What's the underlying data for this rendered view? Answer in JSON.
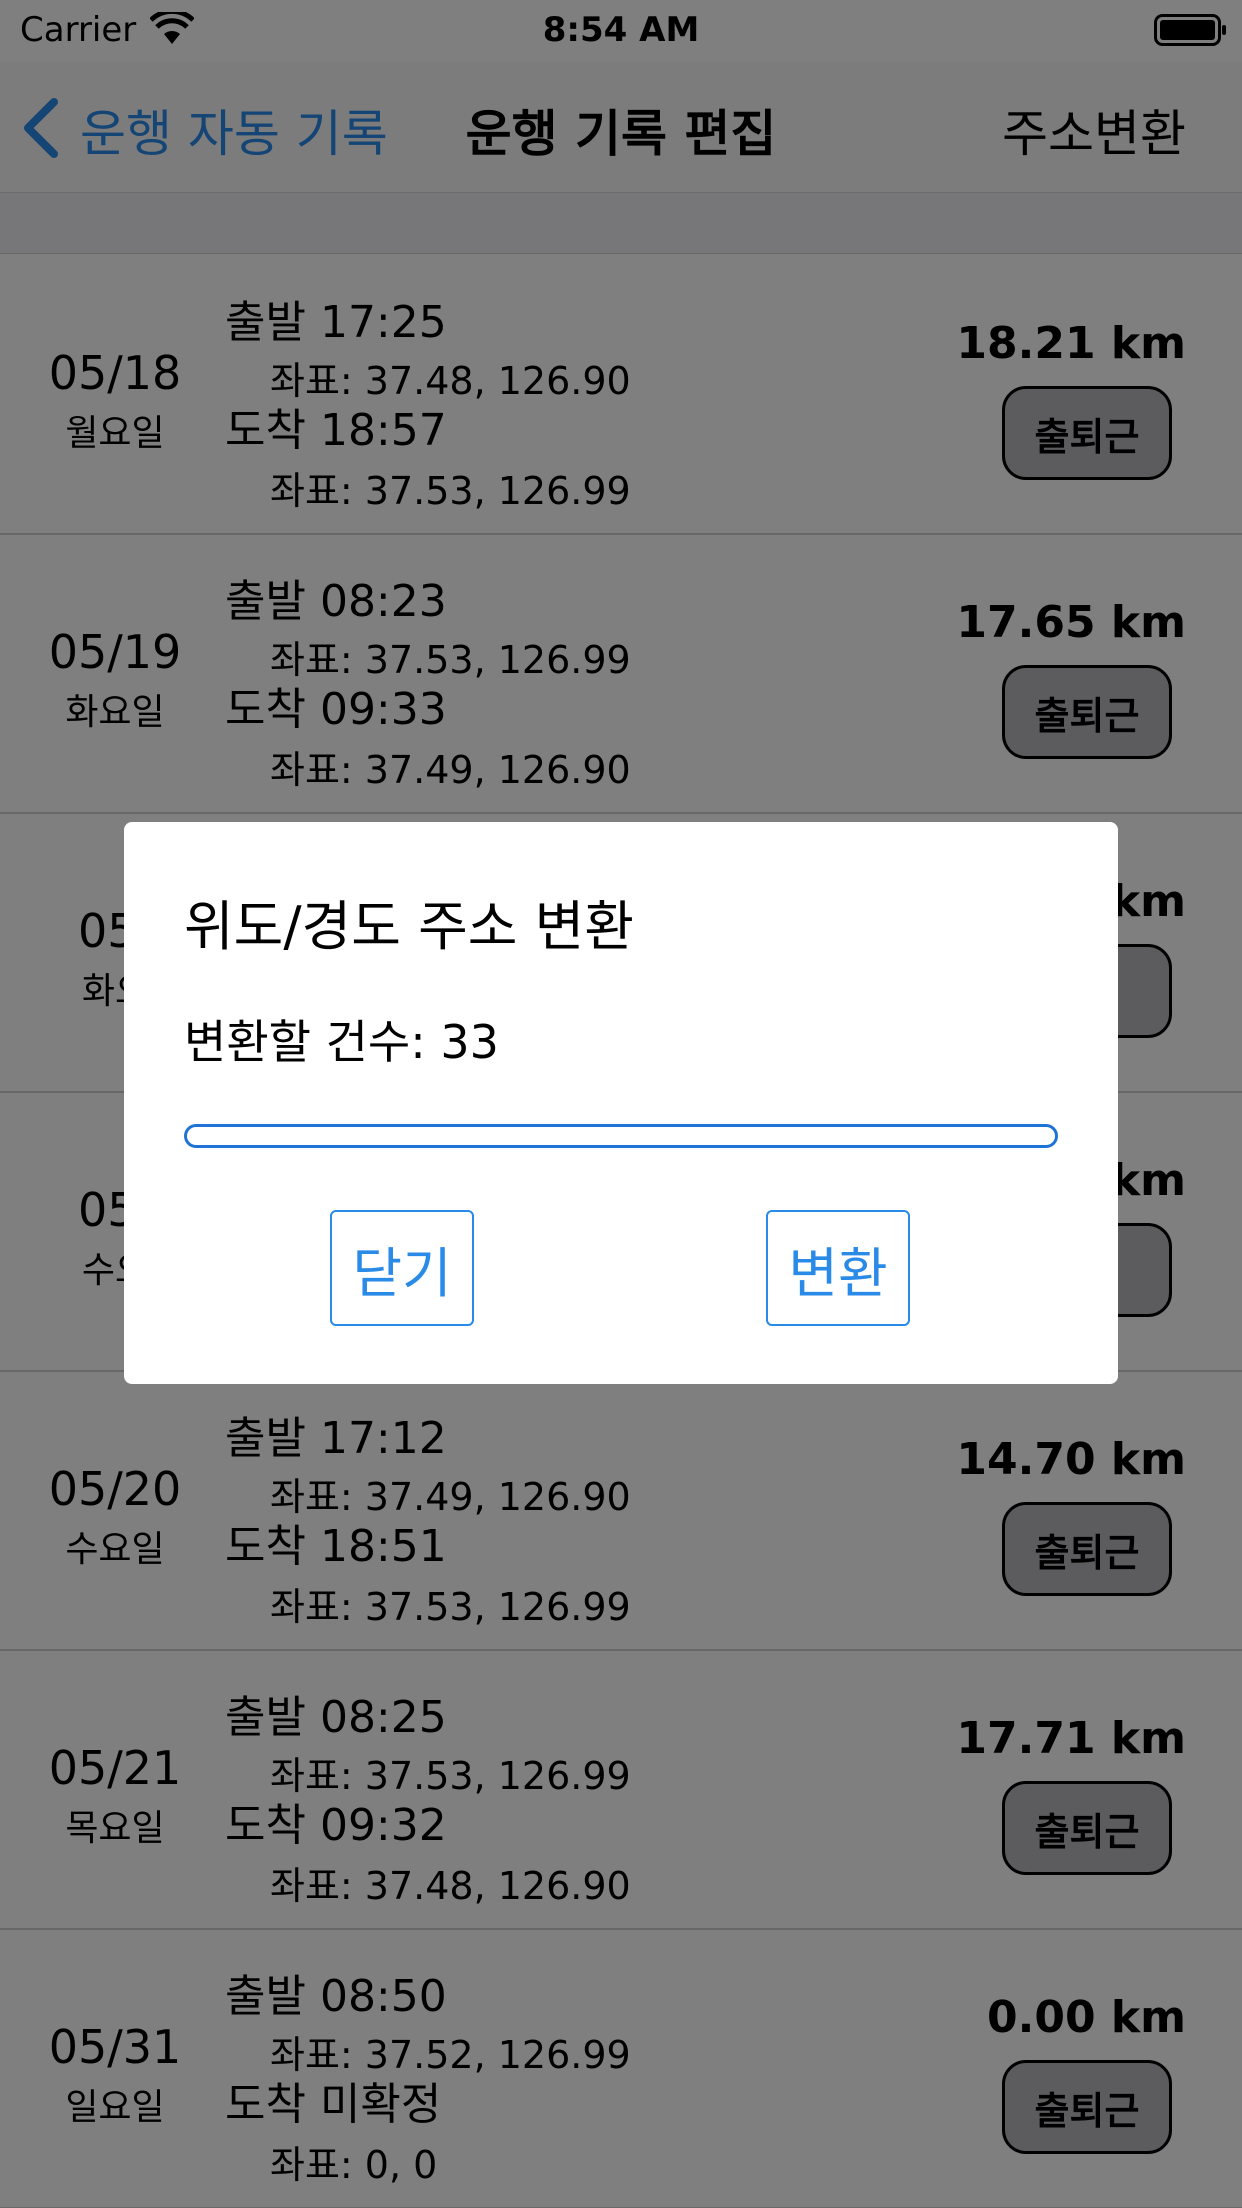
{
  "status_bar": {
    "carrier": "Carrier",
    "time": "8:54 AM"
  },
  "nav": {
    "back_label": "운행 자동 기록",
    "title": "운행 기록 편집",
    "right_action": "주소변환"
  },
  "trips": [
    {
      "date": "05/18",
      "weekday": "월요일",
      "depart": "출발 17:25",
      "depart_coord": "좌표: 37.48, 126.90",
      "arrive": "도착 18:57",
      "arrive_coord": "좌표: 37.53, 126.99",
      "distance": "18.21 km",
      "category": "출퇴근"
    },
    {
      "date": "05/19",
      "weekday": "화요일",
      "depart": "출발 08:23",
      "depart_coord": "좌표: 37.53, 126.99",
      "arrive": "도착 09:33",
      "arrive_coord": "좌표: 37.49, 126.90",
      "distance": "17.65 km",
      "category": "출퇴근"
    },
    {
      "date": "05/",
      "weekday": "화요",
      "distance": "km",
      "category": "근"
    },
    {
      "date": "05/",
      "weekday": "수요",
      "distance": "km",
      "category": "근"
    },
    {
      "date": "05/20",
      "weekday": "수요일",
      "depart": "출발 17:12",
      "depart_coord": "좌표: 37.49, 126.90",
      "arrive": "도착 18:51",
      "arrive_coord": "좌표: 37.53, 126.99",
      "distance": "14.70 km",
      "category": "출퇴근"
    },
    {
      "date": "05/21",
      "weekday": "목요일",
      "depart": "출발 08:25",
      "depart_coord": "좌표: 37.53, 126.99",
      "arrive": "도착 09:32",
      "arrive_coord": "좌표: 37.48, 126.90",
      "distance": "17.71 km",
      "category": "출퇴근"
    },
    {
      "date": "05/31",
      "weekday": "일요일",
      "depart": "출발 08:50",
      "depart_coord": "좌표: 37.52, 126.99",
      "arrive": "도착 미확정",
      "arrive_coord": "좌표: 0, 0",
      "distance": "0.00 km",
      "category": "출퇴근"
    }
  ],
  "dialog": {
    "title": "위도/경도 주소 변환",
    "count_text": "변환할 건수: 33",
    "progress": 0,
    "close_label": "닫기",
    "convert_label": "변환"
  },
  "colors": {
    "accent": "#2A8AE8",
    "progress": "#1F73D6",
    "overlay": "rgba(0,0,0,0.5)"
  },
  "icons": {
    "wifi": "wifi-icon",
    "battery": "battery-icon",
    "back": "chevron-left-icon"
  }
}
